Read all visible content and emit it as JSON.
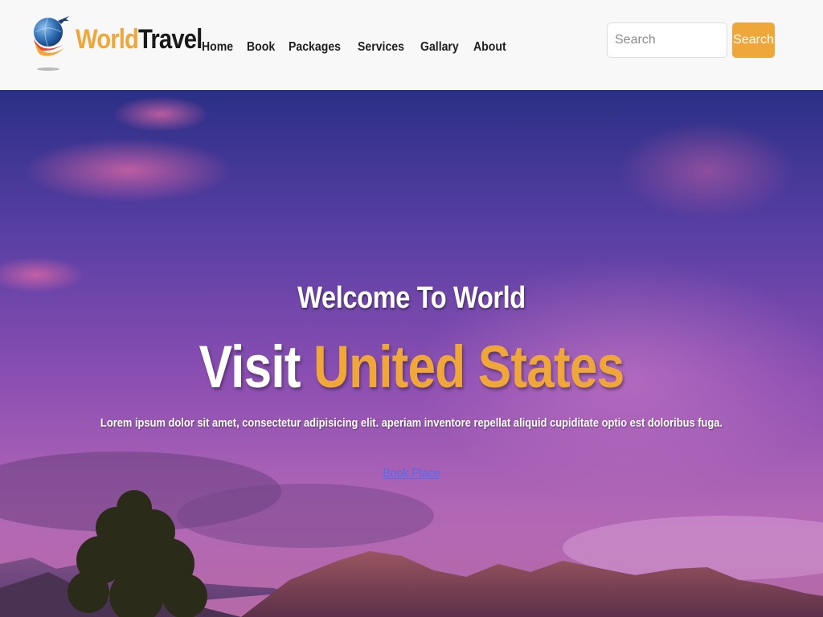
{
  "brand": {
    "word1": "World",
    "word2": "Travel",
    "logo_icon": "globe-airplane-logo-icon"
  },
  "nav": {
    "items": [
      {
        "label": "Home"
      },
      {
        "label": "Book"
      },
      {
        "label": "Packages"
      },
      {
        "label": "Services"
      },
      {
        "label": "Gallary"
      },
      {
        "label": "About"
      }
    ]
  },
  "search": {
    "placeholder": "Search",
    "value": "",
    "button_label": "Search"
  },
  "hero": {
    "welcome": "Welcome To World",
    "headline_prefix": "Visit",
    "headline_accent": "United States",
    "lede": "Lorem ipsum dolor sit amet, consectetur adipisicing elit. aperiam inventore repellat aliquid cupiditate optio est doloribus fuga.",
    "cta_label": "Book Place"
  },
  "colors": {
    "accent": "#f0a73a",
    "link": "#4d6ef0",
    "navbar_bg": "#f8f8f8"
  }
}
